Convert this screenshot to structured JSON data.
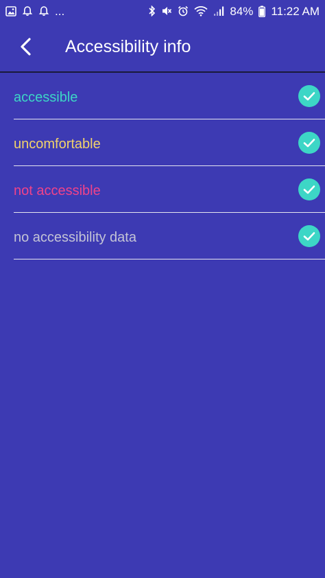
{
  "status_bar": {
    "battery_percent": "84%",
    "time": "11:22 AM",
    "overflow": "..."
  },
  "header": {
    "title": "Accessibility info",
    "back_icon": "chevron-left-icon"
  },
  "items": [
    {
      "label": "accessible",
      "color": "#3dd6c6",
      "checked": true
    },
    {
      "label": "uncomfortable",
      "color": "#f2d36b",
      "checked": true
    },
    {
      "label": "not accessible",
      "color": "#f0438a",
      "checked": true
    },
    {
      "label": "no accessibility data",
      "color": "#c4c4d6",
      "checked": true
    }
  ],
  "colors": {
    "background": "#3d3ab3",
    "check_fill": "#3dd6c6"
  }
}
